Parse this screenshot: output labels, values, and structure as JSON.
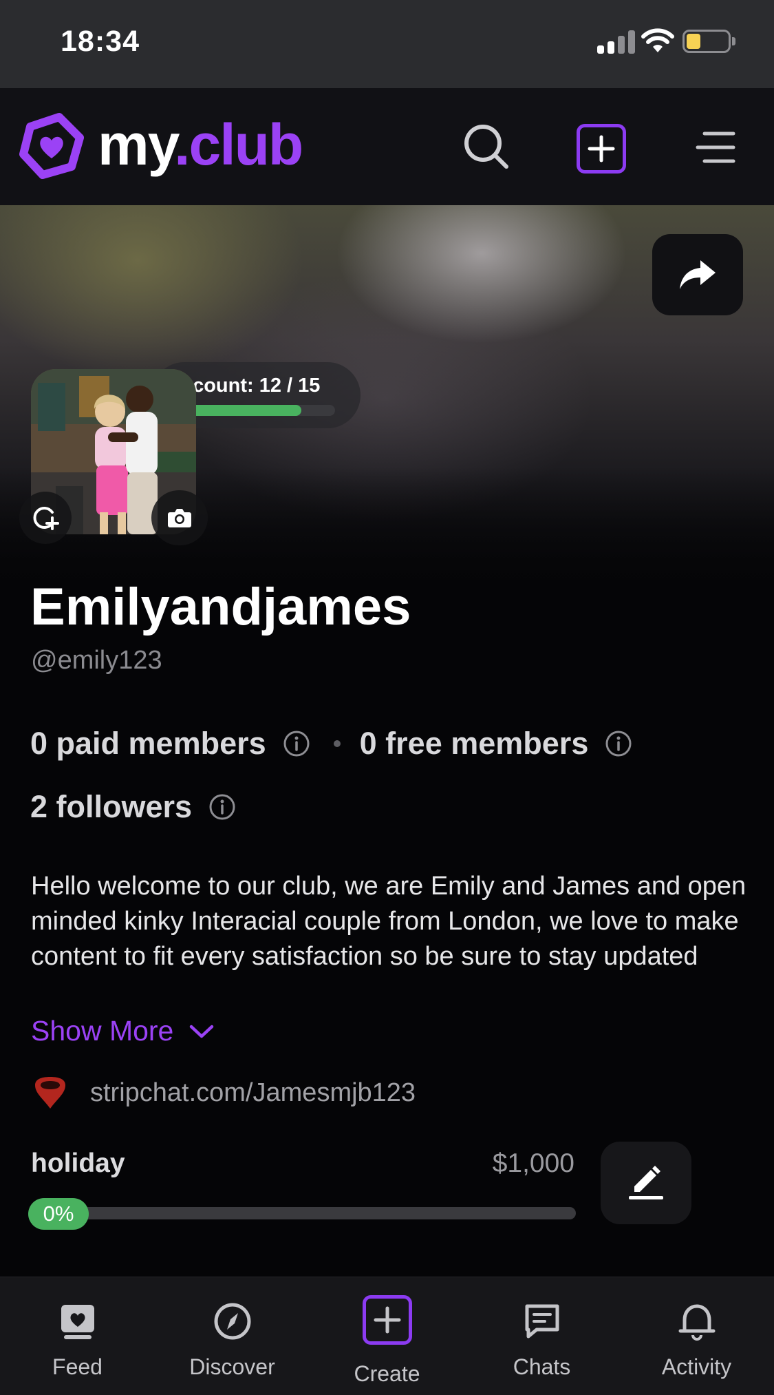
{
  "status_bar": {
    "time": "18:34"
  },
  "brand": {
    "logo_text_main": "my",
    "logo_text_accent": ".club",
    "accent_color": "#9b42f5"
  },
  "header": {
    "icons": [
      "search-icon",
      "create-icon",
      "menu-icon"
    ]
  },
  "cover": {
    "share_icon": "share-arrow-icon"
  },
  "account": {
    "label": "Account: 12 / 15",
    "completed": 12,
    "total": 15,
    "progress_fraction": 0.8,
    "bar_color": "#49b25f"
  },
  "profile": {
    "display_name": "Emilyandjames",
    "handle": "@emily123",
    "paid_members": "0 paid members",
    "free_members": "0 free members",
    "followers": "2 followers",
    "bio": "Hello welcome to our club, we are Emily and James and open minded kinky Interacial couple from London, we love to make content to fit every satisfaction so be sure to stay updated",
    "show_more": "Show More",
    "link": "stripchat.com/Jamesmjb123"
  },
  "goal": {
    "title": "holiday",
    "amount": "$1,000",
    "progress_label": "0%",
    "progress_fraction": 0.0
  },
  "tabs": [
    {
      "label": "Feed",
      "icon": "feed-icon"
    },
    {
      "label": "Discover",
      "icon": "compass-icon"
    },
    {
      "label": "Create",
      "icon": "create-icon"
    },
    {
      "label": "Chats",
      "icon": "chat-icon"
    },
    {
      "label": "Activity",
      "icon": "bell-icon"
    }
  ]
}
